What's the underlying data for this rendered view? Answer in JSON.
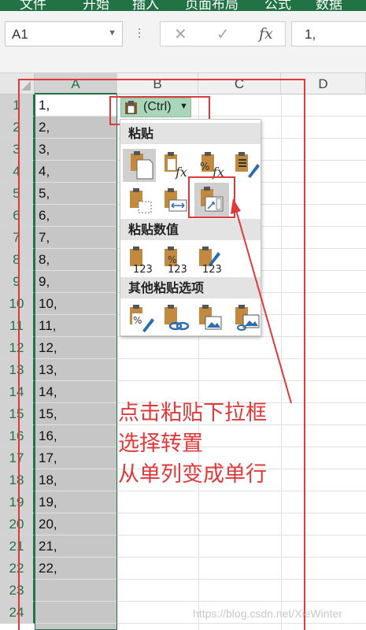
{
  "ribbon": {
    "tabs": [
      "文件",
      "开始",
      "插入",
      "页面布局",
      "公式",
      "数据"
    ]
  },
  "formula_bar": {
    "name_box": "A1",
    "cancel_symbol": "✕",
    "enter_symbol": "✓",
    "fx_symbol": "fx",
    "content": "1,"
  },
  "sheet": {
    "columns": [
      "A",
      "B",
      "C",
      "D"
    ],
    "rows": [
      "1",
      "2",
      "3",
      "4",
      "5",
      "6",
      "7",
      "8",
      "9",
      "10",
      "11",
      "12",
      "13",
      "14",
      "15",
      "16",
      "17",
      "18",
      "19",
      "20",
      "21",
      "22",
      "23",
      "24"
    ],
    "column_a_values": [
      "1,",
      "2,",
      "3,",
      "4,",
      "5,",
      "6,",
      "7,",
      "8,",
      "9,",
      "10,",
      "11,",
      "12,",
      "13,",
      "14,",
      "15,",
      "16,",
      "17,",
      "18,",
      "19,",
      "20,",
      "21,",
      "22,"
    ]
  },
  "paste_button": {
    "label": "(Ctrl)"
  },
  "paste_menu": {
    "section_paste": "粘贴",
    "section_paste_values": "粘贴数值",
    "section_other": "其他粘贴选项",
    "paste_options": [
      "paste-icon",
      "formulas-icon",
      "formulas-number-format-icon",
      "keep-source-formatting-icon",
      "no-borders-icon",
      "keep-column-widths-icon",
      "transpose-icon"
    ],
    "value_options": [
      "values-icon",
      "values-number-format-icon",
      "values-source-formatting-icon"
    ],
    "other_options": [
      "formatting-icon",
      "paste-link-icon",
      "picture-icon",
      "linked-picture-icon"
    ]
  },
  "annotation": {
    "lines": [
      "点击粘贴下拉框",
      "选择转置",
      "从单列变成单行"
    ]
  },
  "watermark": "https://blog.csdn.net/XieWinter",
  "colors": {
    "excel_green": "#217346",
    "annotation_red": "#e0393a",
    "selection_gray": "#c6c6c6",
    "paste_button_green": "#a9d5b9"
  }
}
